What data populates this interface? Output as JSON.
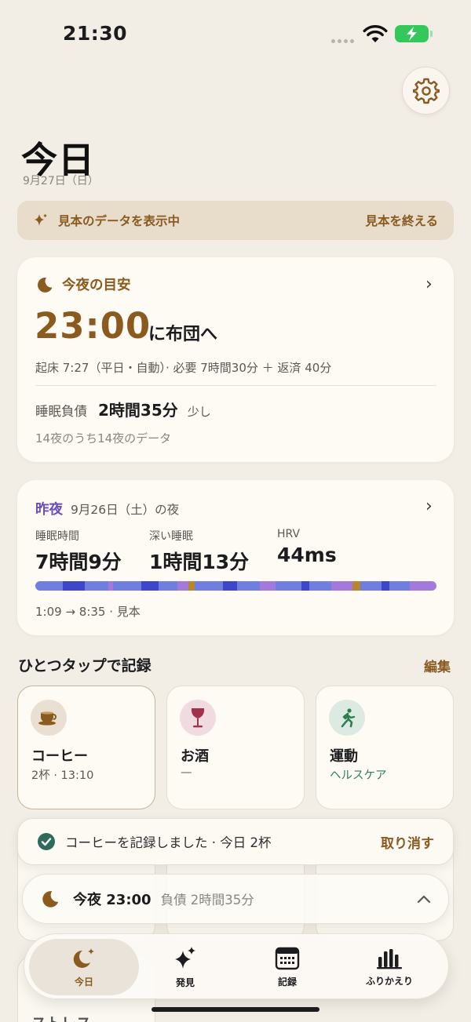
{
  "status_bar": {
    "time": "21:30"
  },
  "header": {
    "title": "今日",
    "date": "9月27日（日）"
  },
  "sample_banner": {
    "label": "見本のデータを表示中",
    "end_label": "見本を終える"
  },
  "tonight": {
    "heading": "今夜の目安",
    "bedtime": "23:00",
    "bedtime_suffix": "に布団へ",
    "wake_line": "起床 7:27（平日・自動）· 必要 7時間30分 ＋ 返済 40分",
    "debt_label": "睡眠負債",
    "debt_value": "2時間35分",
    "debt_level": "少し",
    "nights_line": "14夜のうち14夜のデータ"
  },
  "last_night": {
    "heading": "昨夜",
    "date": "9月26日（土）の夜",
    "stats": [
      {
        "label": "睡眠時間",
        "value": "7時間9分"
      },
      {
        "label": "深い睡眠",
        "value": "1時間13分"
      },
      {
        "label": "HRV",
        "value": "44ms"
      }
    ],
    "time_range": "1:09 → 8:35 · 見本",
    "stage_colors": {
      "light": "#6f7fe0",
      "deep": "#3d47cc",
      "rem": "#a479dc",
      "awake": "#b8862e"
    }
  },
  "quick_log": {
    "title": "ひとつタップで記録",
    "edit_label": "編集",
    "items": [
      {
        "name": "コーヒー",
        "sub": "2杯 · 13:10",
        "icon": "coffee-cup-icon"
      },
      {
        "name": "お酒",
        "sub": "—",
        "icon": "wine-glass-icon"
      },
      {
        "name": "運動",
        "sub": "ヘルスケア",
        "icon": "running-icon"
      }
    ],
    "partial_label": "ストレス"
  },
  "toast": {
    "message": "コーヒーを記録しました · 今日 2杯",
    "undo_label": "取り消す"
  },
  "mini_bar": {
    "title": "今夜 23:00",
    "detail": "負債 2時間35分"
  },
  "tabs": [
    {
      "label": "今日",
      "icon": "moon-sparkle-icon",
      "active": true
    },
    {
      "label": "発見",
      "icon": "sparkles-icon"
    },
    {
      "label": "記録",
      "icon": "calendar-icon"
    },
    {
      "label": "ふりかえり",
      "icon": "bar-chart-icon"
    }
  ],
  "colors": {
    "accent_brown": "#8a5a1f",
    "accent_purple": "#6b4cc0",
    "background": "#f2ede5",
    "card": "#fefbf4",
    "success_green": "#2e6b5a"
  }
}
